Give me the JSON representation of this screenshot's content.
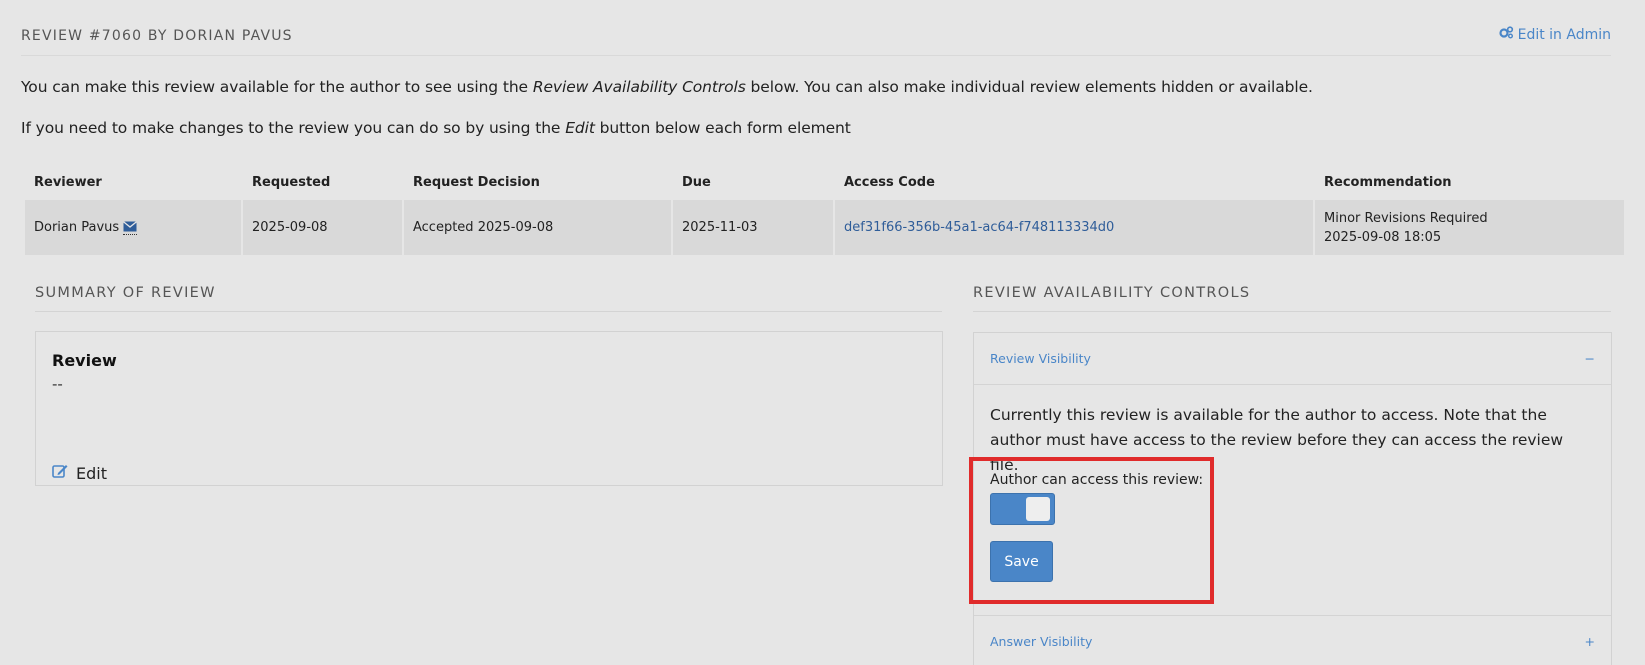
{
  "header": {
    "title": "REVIEW #7060 BY DORIAN PAVUS",
    "admin_link": "Edit in Admin",
    "admin_icon": "gears-icon"
  },
  "intro": {
    "line1_a": "You can make this review available for the author to see using the ",
    "line1_em": "Review Availability Controls",
    "line1_b": " below. You can also make individual review elements hidden or available.",
    "line2_a": "If you need to make changes to the review you can do so by using the ",
    "line2_em": "Edit",
    "line2_b": " button below each form element"
  },
  "table": {
    "headers": [
      "Reviewer",
      "Requested",
      "Request Decision",
      "Due",
      "Access Code",
      "Recommendation"
    ],
    "row": {
      "reviewer": "Dorian Pavus",
      "requested": "2025-09-08",
      "decision": "Accepted 2025-09-08",
      "due": "2025-11-03",
      "access_code": "def31f66-356b-45a1-ac64-f748113334d0",
      "recommendation": "Minor Revisions Required",
      "recommendation_date": "2025-09-08 18:05"
    }
  },
  "summary": {
    "heading": "SUMMARY OF REVIEW",
    "card_title": "Review",
    "card_value": "--",
    "edit_label": "Edit"
  },
  "availability": {
    "heading": "REVIEW AVAILABILITY CONTROLS",
    "visibility_title": "Review Visibility",
    "visibility_toggle": "−",
    "text": "Currently this review is available for the author to access. Note that the author must have access to the review before they can access the review file.",
    "author_label": "Author can access this review:",
    "author_access_enabled": true,
    "save_label": "Save",
    "answer_title": "Answer Visibility",
    "answer_toggle": "+"
  },
  "colors": {
    "accent": "#4a86c8",
    "highlight": "#e02b2b",
    "background": "#e6e6e6"
  }
}
